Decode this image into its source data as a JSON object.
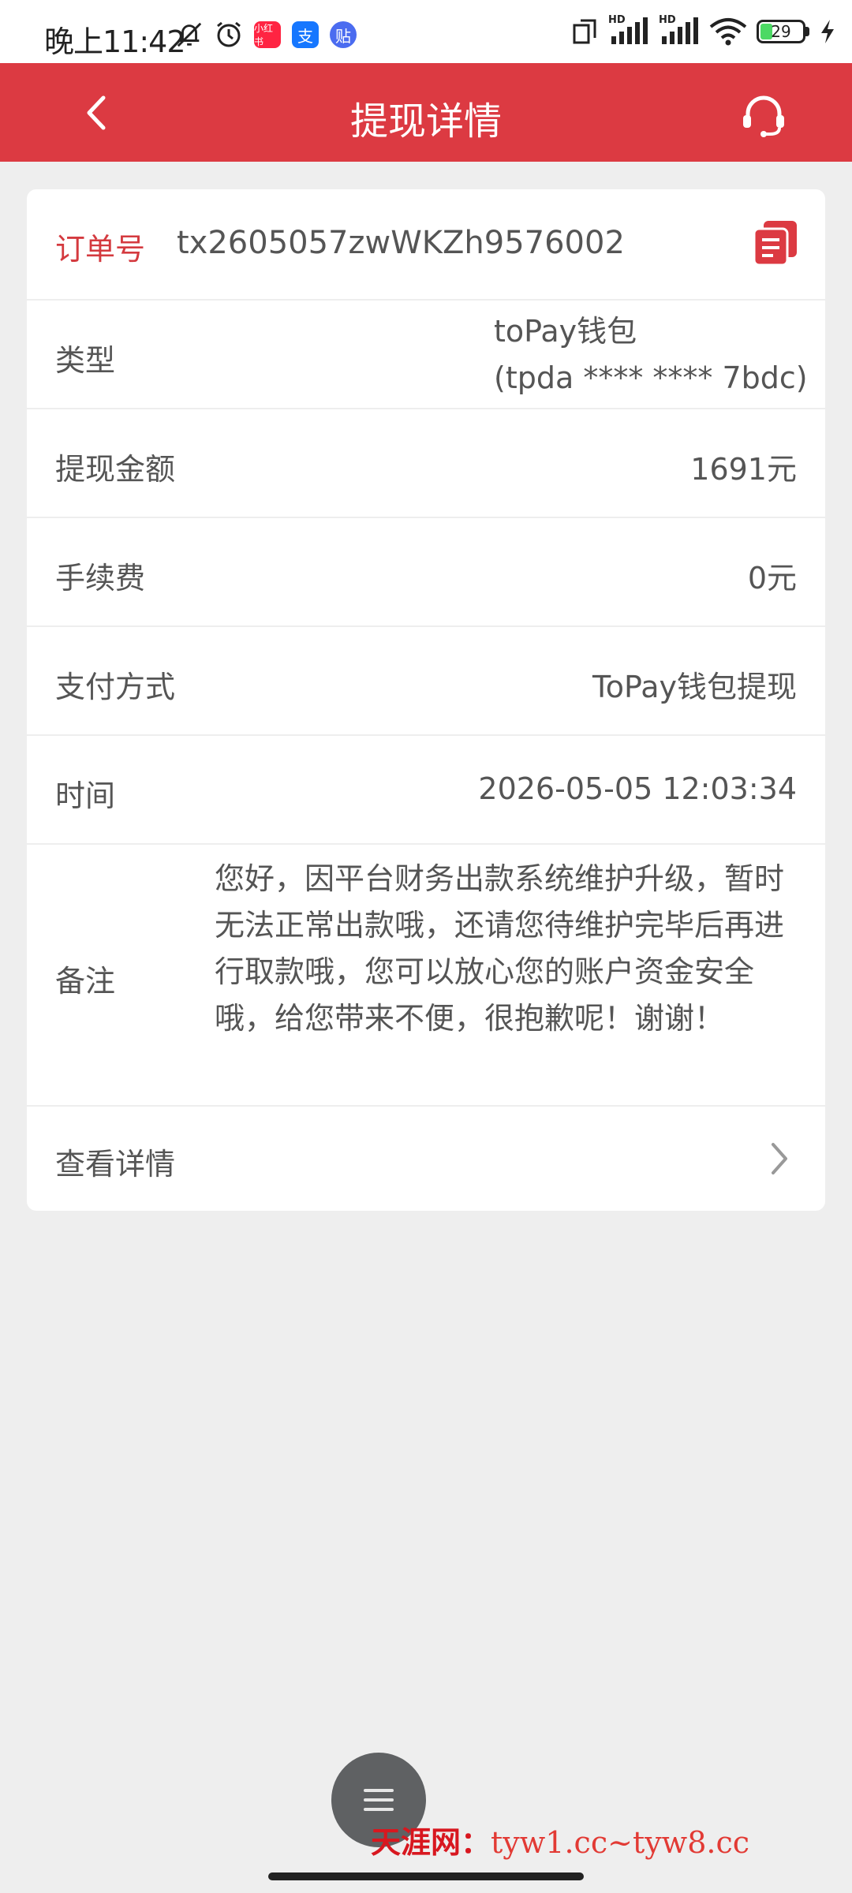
{
  "status_bar": {
    "time": "晚上11:42",
    "apps": [
      {
        "name": "xiaohongshu",
        "text": "小红书",
        "color": "#ff2442"
      },
      {
        "name": "alipay",
        "text": "支",
        "color": "#1677ff"
      },
      {
        "name": "tieba",
        "text": "贴",
        "color": "#4b6cf0"
      }
    ],
    "network_1": "HD",
    "network_2": "HD",
    "battery": "29"
  },
  "header": {
    "title": "提现详情"
  },
  "order": {
    "label": "订单号",
    "value": "tx2605057zwWKZh9576002"
  },
  "rows": {
    "type": {
      "label": "类型",
      "value_line1": "toPay钱包",
      "value_line2": "(tpda **** **** 7bdc)"
    },
    "amount": {
      "label": "提现金额",
      "value": "1691元"
    },
    "fee": {
      "label": "手续费",
      "value": "0元"
    },
    "method": {
      "label": "支付方式",
      "value": "ToPay钱包提现"
    },
    "time": {
      "label": "时间",
      "value": "2026-05-05 12:03:34"
    },
    "remark": {
      "label": "备注",
      "value": "您好，因平台财务出款系统维护升级，暂时无法正常出款哦，还请您待维护完毕后再进行取款哦，您可以放心您的账户资金安全哦，给您带来不便，很抱歉呢！谢谢！"
    },
    "details": {
      "label": "查看详情"
    }
  },
  "watermark": {
    "brand": "天涯网：",
    "site": "tyw1.cc~tyw8.cc"
  },
  "colors": {
    "accent": "#dc3a42",
    "background": "#eeeeee"
  }
}
